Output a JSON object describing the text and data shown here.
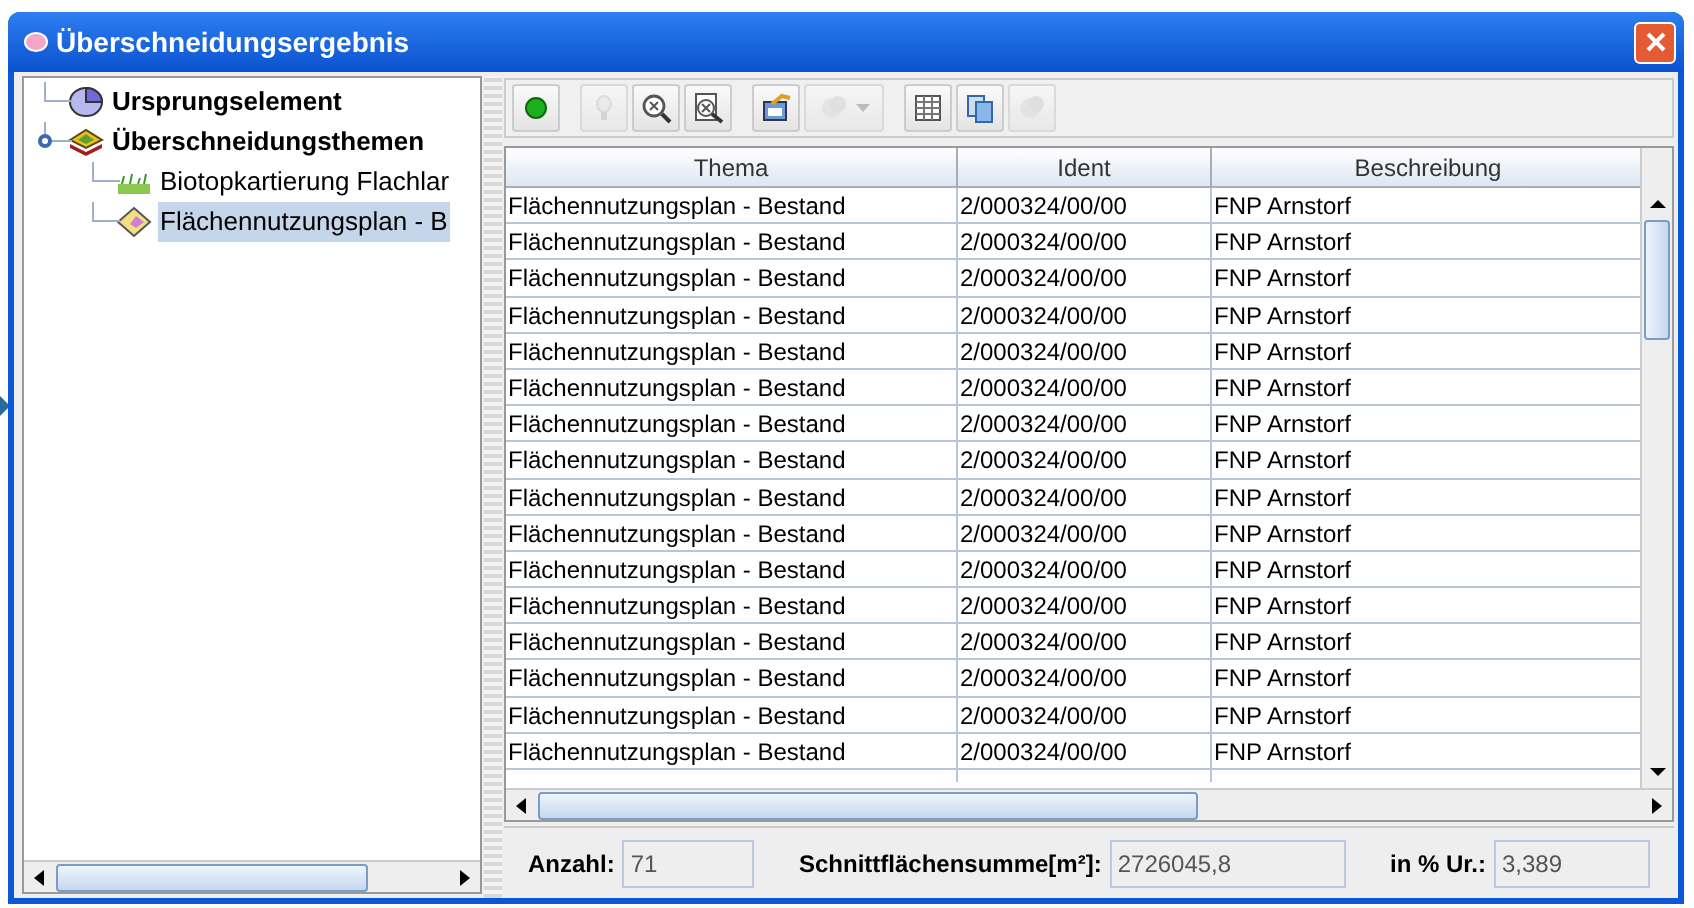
{
  "window": {
    "title": "Überschneidungsergebnis"
  },
  "tree": [
    {
      "label": "Ursprungselement",
      "kind": "origin",
      "selected": false
    },
    {
      "label": "Überschneidungsthemen",
      "kind": "themes",
      "selected": false,
      "expanded": true,
      "children": [
        {
          "label": "Biotopkartierung Flachlar",
          "kind": "biotope",
          "selected": false
        },
        {
          "label": "Flächennutzungsplan - B",
          "kind": "plan",
          "selected": true
        }
      ]
    }
  ],
  "toolbar": [
    {
      "kind": "dot",
      "disabled": false
    },
    {
      "kind": "bulb",
      "disabled": true
    },
    {
      "kind": "zoomx",
      "disabled": false
    },
    {
      "kind": "zoomdoc",
      "disabled": false
    },
    {
      "kind": "export",
      "disabled": false
    },
    {
      "kind": "dropdown",
      "disabled": true
    },
    {
      "kind": "table",
      "disabled": false
    },
    {
      "kind": "copy",
      "disabled": false
    },
    {
      "kind": "blob",
      "disabled": true
    }
  ],
  "table": {
    "columns": [
      "Thema",
      "Ident",
      "Beschreibung"
    ],
    "rows": [
      [
        "Flächennutzungsplan - Bestand",
        "2/000324/00/00",
        "FNP Arnstorf"
      ],
      [
        "Flächennutzungsplan - Bestand",
        "2/000324/00/00",
        "FNP Arnstorf"
      ],
      [
        "Flächennutzungsplan - Bestand",
        "2/000324/00/00",
        "FNP Arnstorf"
      ],
      [
        "Flächennutzungsplan - Bestand",
        "2/000324/00/00",
        "FNP Arnstorf"
      ],
      [
        "Flächennutzungsplan - Bestand",
        "2/000324/00/00",
        "FNP Arnstorf"
      ],
      [
        "Flächennutzungsplan - Bestand",
        "2/000324/00/00",
        "FNP Arnstorf"
      ],
      [
        "Flächennutzungsplan - Bestand",
        "2/000324/00/00",
        "FNP Arnstorf"
      ],
      [
        "Flächennutzungsplan - Bestand",
        "2/000324/00/00",
        "FNP Arnstorf"
      ],
      [
        "Flächennutzungsplan - Bestand",
        "2/000324/00/00",
        "FNP Arnstorf"
      ],
      [
        "Flächennutzungsplan - Bestand",
        "2/000324/00/00",
        "FNP Arnstorf"
      ],
      [
        "Flächennutzungsplan - Bestand",
        "2/000324/00/00",
        "FNP Arnstorf"
      ],
      [
        "Flächennutzungsplan - Bestand",
        "2/000324/00/00",
        "FNP Arnstorf"
      ],
      [
        "Flächennutzungsplan - Bestand",
        "2/000324/00/00",
        "FNP Arnstorf"
      ],
      [
        "Flächennutzungsplan - Bestand",
        "2/000324/00/00",
        "FNP Arnstorf"
      ],
      [
        "Flächennutzungsplan - Bestand",
        "2/000324/00/00",
        "FNP Arnstorf"
      ],
      [
        "Flächennutzungsplan - Bestand",
        "2/000324/00/00",
        "FNP Arnstorf"
      ]
    ]
  },
  "summary": [
    {
      "label": "Anzahl:",
      "value": "71"
    },
    {
      "label": "Schnittflächensumme[m²]:",
      "value": "2726045,8"
    },
    {
      "label": "in % Ur.:",
      "value": "3,389"
    }
  ]
}
